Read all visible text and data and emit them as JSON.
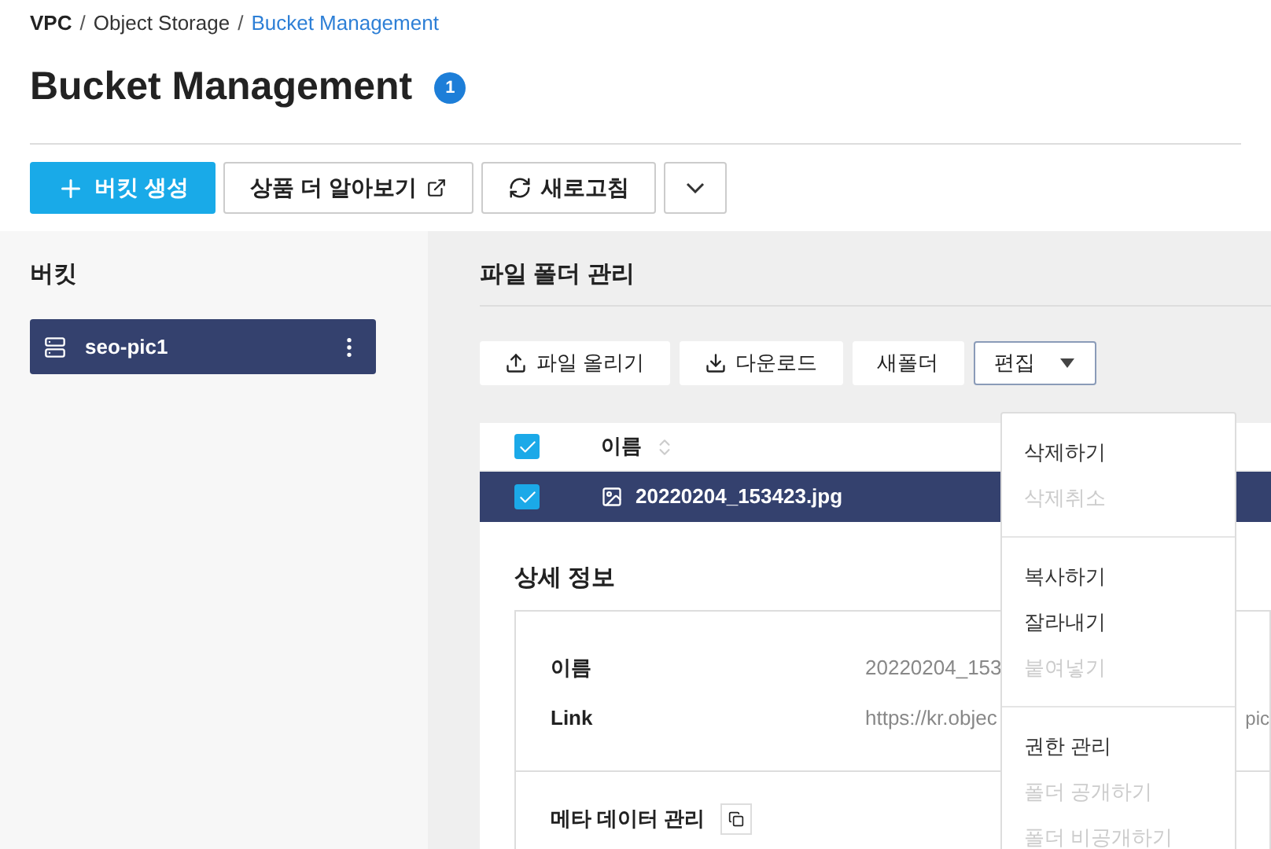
{
  "breadcrumb": [
    {
      "label": "VPC",
      "current": false,
      "separator": "/"
    },
    {
      "label": "Object Storage",
      "current": false,
      "separator": "/"
    },
    {
      "label": "Bucket Management",
      "current": true
    }
  ],
  "title": "Bucket Management",
  "title_badge": "1",
  "actions": [
    {
      "label": "버킷 생성",
      "kind": "primary"
    },
    {
      "label": "상품 더 알아보기",
      "kind": "external"
    },
    {
      "label": "새로고침",
      "kind": "refresh"
    },
    {
      "kind": "more"
    }
  ],
  "sidebar": {
    "heading": "버킷",
    "buckets": [
      {
        "name": "seo-pic1",
        "selected": true
      }
    ]
  },
  "panel": {
    "heading": "파일 폴더 관리",
    "toolbar": [
      {
        "label": "파일 올리기",
        "kind": "upload"
      },
      {
        "label": "다운로드",
        "kind": "download"
      },
      {
        "label": "새폴더",
        "kind": "plain"
      },
      {
        "label": "편집",
        "kind": "dropdown",
        "expanded": true
      }
    ],
    "menu": [
      {
        "label": "삭제하기",
        "disabled": false,
        "group_start": false
      },
      {
        "label": "삭제취소",
        "disabled": true,
        "group_start": false
      },
      {
        "label": "복사하기",
        "disabled": false,
        "group_start": true
      },
      {
        "label": "잘라내기",
        "disabled": false,
        "group_start": false
      },
      {
        "label": "붙여넣기",
        "disabled": true,
        "group_start": false
      },
      {
        "label": "권한 관리",
        "disabled": false,
        "group_start": true
      },
      {
        "label": "폴더 공개하기",
        "disabled": true,
        "group_start": false
      },
      {
        "label": "폴더 비공개하기",
        "disabled": true,
        "group_start": false
      }
    ],
    "table": {
      "header_checked": true,
      "column": "이름",
      "rows": [
        {
          "name": "20220204_153423.jpg",
          "checked": true,
          "selected": true
        }
      ]
    },
    "details": {
      "heading": "상세 정보",
      "fields": [
        {
          "label": "이름",
          "value": "20220204_153"
        },
        {
          "label": "Link",
          "value": "https://kr.objec",
          "tail": "pic"
        }
      ],
      "meta_label": "메타 데이터 관리"
    }
  }
}
